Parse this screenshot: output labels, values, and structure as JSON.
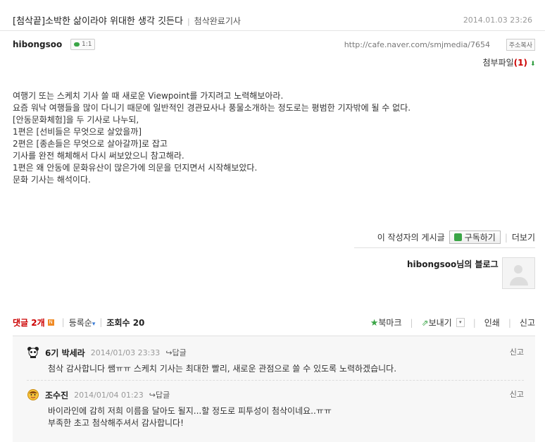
{
  "post": {
    "title": "[첨삭끝]소박한 삶이라야 위대한 생각 깃든다",
    "category": "첨삭완료기사",
    "date": "2014.01.03 23:26",
    "author": "hibongsoo",
    "comment_badge": "1:1",
    "url": "http://cafe.naver.com/smjmedia/7654",
    "copy_label": "주소복사",
    "attach_label": "첨부파일",
    "attach_count": "(1)",
    "body": [
      "여행기 또는 스케치 기사 쓸 때 새로운 Viewpoint를 가지려고 노력해보아라.",
      "요즘 워낙 여행들을 많이 다니기 때문에 일반적인 경관묘사나 풍물소개하는 정도로는 평범한 기자밖에 될 수 없다.",
      "[안동문화체험]을 두 기사로 나누되,",
      "1편은 [선비들은 무엇으로 살았을까]",
      "2편은 [종손들은 무엇으로 살아갈까]로 잡고",
      "기사를 완전 해체해서 다시 써보았으니 참고해라.",
      "1편은 왜 안동에 문화유산이 많은가에 의문을 던지면서 시작해보았다.",
      "문화 기사는 해석이다."
    ]
  },
  "writer": {
    "posts_label": "이 작성자의 게시글",
    "subscribe_label": "구독하기",
    "more_label": "더보기",
    "blog_label": "hibongsoo님의 블로그"
  },
  "toolbar": {
    "comments_label": "댓글 2개",
    "new_badge": "N",
    "sort_label": "등록순",
    "sort_arrow": "▾",
    "views_label": "조회수 20",
    "bookmark_label": "북마크",
    "send_label": "보내기",
    "print_label": "인쇄",
    "report_label": "신고"
  },
  "comments": [
    {
      "name": "6기 박세라",
      "date": "2014/01/03 23:33",
      "reply": "↪답글",
      "report": "신고",
      "text": [
        "첨삭 감사합니다 쌤ㅠㅠ 스케치 기사는 최대한 빨리, 새로운 관점으로 쓸 수 있도록 노력하겠습니다."
      ],
      "icon": "panda-icon"
    },
    {
      "name": "조수진",
      "date": "2014/01/04 01:23",
      "reply": "↪답글",
      "report": "신고",
      "text": [
        "바이라인에 감히 저희 이름을 달아도 될지...할 정도로 피투성이 첨삭이네요..ㅠㅠ",
        "부족한 초고 첨삭해주셔서 감사합니다!"
      ],
      "icon": "face-icon"
    }
  ]
}
